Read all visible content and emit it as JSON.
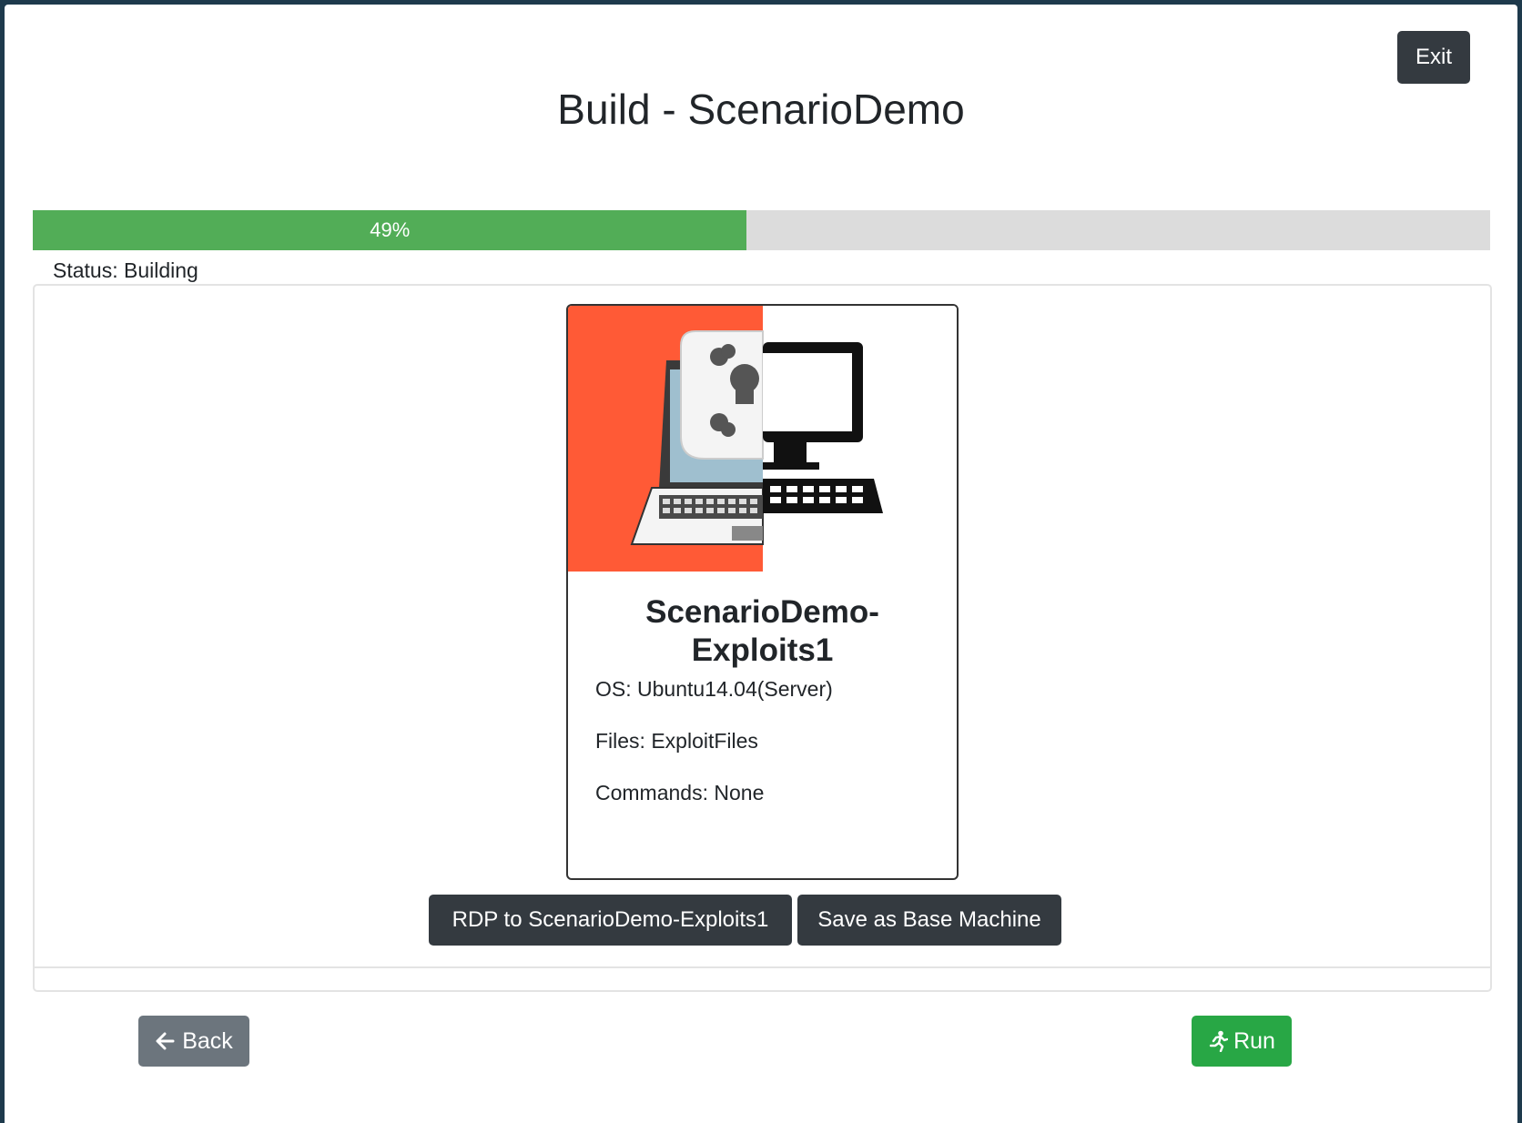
{
  "header": {
    "title": "Build - ScenarioDemo",
    "exit_label": "Exit"
  },
  "progress": {
    "percent": 49,
    "label": "49%",
    "bar_color": "#52ad57",
    "track_color": "#dcdcdc"
  },
  "status": {
    "text": "Status: Building"
  },
  "machine": {
    "image_icon": "laptop-skull-and-desktop-icon",
    "name_line1": "ScenarioDemo-",
    "name_line2": "Exploits1",
    "os": "OS: Ubuntu14.04(Server)",
    "files": "Files: ExploitFiles",
    "commands": "Commands: None"
  },
  "actions": {
    "rdp_label": "RDP to ScenarioDemo-Exploits1",
    "save_base_label": "Save as Base Machine"
  },
  "footer": {
    "back_label": "Back",
    "back_icon": "arrow-left-icon",
    "run_label": "Run",
    "run_icon": "running-person-icon"
  },
  "colors": {
    "dark_button": "#343a40",
    "secondary_button": "#6c757d",
    "success_button": "#28a745",
    "card_image_bg": "#ff5a36"
  }
}
